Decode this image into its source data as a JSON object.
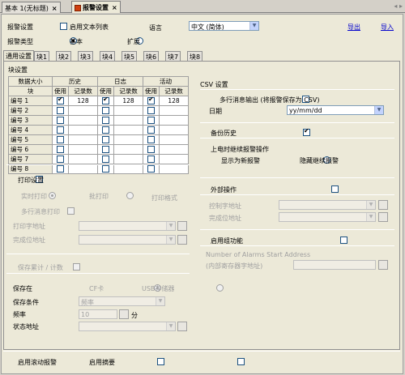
{
  "tabs": [
    {
      "label": "基本 1(无标题)",
      "close": "×"
    },
    {
      "label": "报警设置",
      "close": "×"
    }
  ],
  "nav": {
    "prev": "◂",
    "next": "▸"
  },
  "header": {
    "alarm_settings_label": "报警设置",
    "use_text_list_label": "启用文本列表",
    "language_label": "语言",
    "language_value": "中文 (简体)",
    "export_link": "导出",
    "import_link": "导入",
    "alarm_type_label": "报警类型",
    "type_basic": "基本",
    "type_extended": "扩展"
  },
  "subtabs": [
    "通用设置",
    "块1",
    "块2",
    "块3",
    "块4",
    "块5",
    "块6",
    "块7",
    "块8"
  ],
  "block_settings": {
    "title": "块设置",
    "col_data_size": "数据大小",
    "col_history": "历史",
    "col_log": "日志",
    "col_active": "活动",
    "col_block": "块",
    "col_use": "使用",
    "col_records": "记录数",
    "rows": [
      {
        "name": "编号 1",
        "h_use": true,
        "h_rec": "128",
        "l_use": true,
        "l_rec": "128",
        "a_use": true,
        "a_rec": "128"
      },
      {
        "name": "编号 2",
        "h_use": false,
        "h_rec": "",
        "l_use": false,
        "l_rec": "",
        "a_use": false,
        "a_rec": ""
      },
      {
        "name": "编号 3",
        "h_use": false,
        "h_rec": "",
        "l_use": false,
        "l_rec": "",
        "a_use": false,
        "a_rec": ""
      },
      {
        "name": "编号 4",
        "h_use": false,
        "h_rec": "",
        "l_use": false,
        "l_rec": "",
        "a_use": false,
        "a_rec": ""
      },
      {
        "name": "编号 5",
        "h_use": false,
        "h_rec": "",
        "l_use": false,
        "l_rec": "",
        "a_use": false,
        "a_rec": ""
      },
      {
        "name": "编号 6",
        "h_use": false,
        "h_rec": "",
        "l_use": false,
        "l_rec": "",
        "a_use": false,
        "a_rec": ""
      },
      {
        "name": "编号 7",
        "h_use": false,
        "h_rec": "",
        "l_use": false,
        "l_rec": "",
        "a_use": false,
        "a_rec": ""
      },
      {
        "name": "编号 8",
        "h_use": false,
        "h_rec": "",
        "l_use": false,
        "l_rec": "",
        "a_use": false,
        "a_rec": ""
      }
    ]
  },
  "print": {
    "title": "打印设置",
    "realtime": "实时打印",
    "batch": "批打印",
    "print_format": "打印格式",
    "multiline": "多行消息打印",
    "print_addr": "打印字地址",
    "done_addr": "完成位地址"
  },
  "save": {
    "title": "保存累计 / 计数",
    "save_in": "保存在",
    "cf_card": "CF卡",
    "usb": "USB存储器",
    "save_condition": "保存条件",
    "condition_value": "频率",
    "frequency": "频率",
    "freq_value": "10",
    "minutes": "分",
    "status_addr": "状态地址"
  },
  "csv": {
    "title": "CSV 设置",
    "multiline_out": "多行消息输出 (将报警保存为 CSV)",
    "date_label": "日期",
    "date_value": "yy/mm/dd"
  },
  "backup": {
    "title": "备份历史",
    "on_power": "上电时继续报警操作",
    "show_new": "显示为新报警",
    "hide_continue": "隐藏继续报警"
  },
  "external": {
    "title": "外部操作",
    "ctrl_addr": "控制字地址",
    "done_addr": "完成位地址"
  },
  "group": {
    "title": "启用组功能",
    "start_addr": "Number of Alarms Start Address",
    "internal_addr": "(内部寄存器字地址)"
  },
  "footer": {
    "scroll_alarm": "启用滚动报警",
    "summary": "启用摘要"
  }
}
